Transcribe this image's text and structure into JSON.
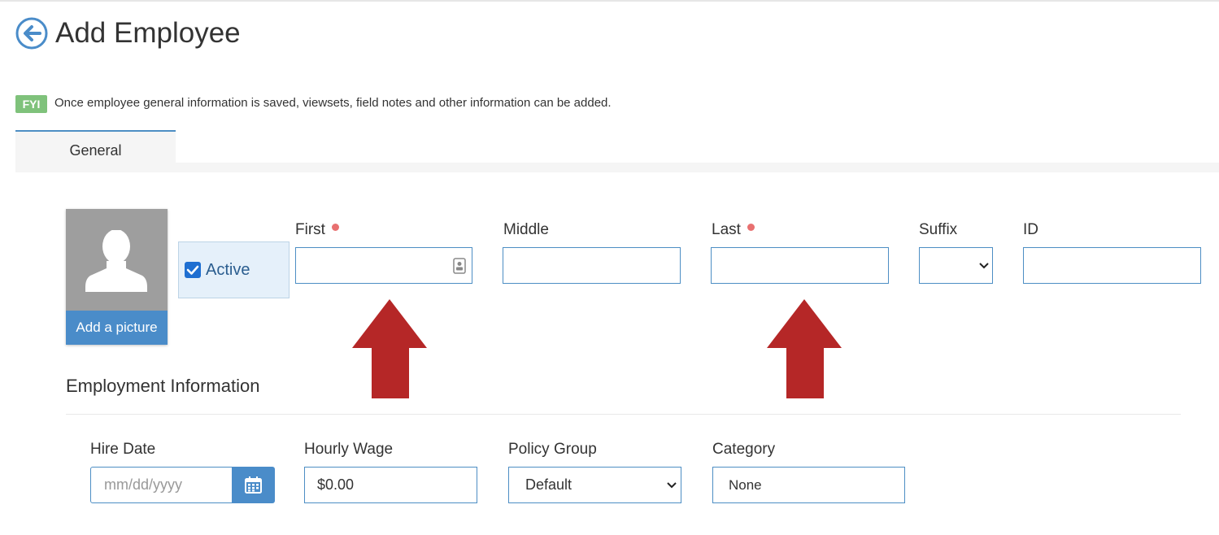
{
  "header": {
    "title": "Add Employee"
  },
  "notice": {
    "badge": "FYI",
    "text": "Once employee general information is saved, viewsets, field notes and other information can be added."
  },
  "tabs": [
    {
      "label": "General",
      "active": true
    }
  ],
  "picture": {
    "button_label": "Add a picture"
  },
  "active": {
    "label": "Active",
    "checked": true
  },
  "name_fields": {
    "first": {
      "label": "First",
      "required": true,
      "value": ""
    },
    "middle": {
      "label": "Middle",
      "value": ""
    },
    "last": {
      "label": "Last",
      "required": true,
      "value": ""
    },
    "suffix": {
      "label": "Suffix",
      "value": ""
    },
    "id": {
      "label": "ID",
      "value": ""
    }
  },
  "employment": {
    "title": "Employment Information",
    "hire_date": {
      "label": "Hire Date",
      "placeholder": "mm/dd/yyyy",
      "value": ""
    },
    "hourly_wage": {
      "label": "Hourly Wage",
      "value": "$0.00"
    },
    "policy_group": {
      "label": "Policy Group",
      "value": "Default"
    },
    "category": {
      "label": "Category",
      "value": "None"
    }
  },
  "colors": {
    "accent": "#4a8cc9",
    "fyi_badge": "#7fc27b",
    "required_dot": "#e87070",
    "annotation_arrow": "#b52727"
  },
  "icons": [
    "back-arrow-icon",
    "person-silhouette-icon",
    "contact-card-icon",
    "chevron-down-icon",
    "calendar-icon",
    "up-arrow-annotation"
  ]
}
